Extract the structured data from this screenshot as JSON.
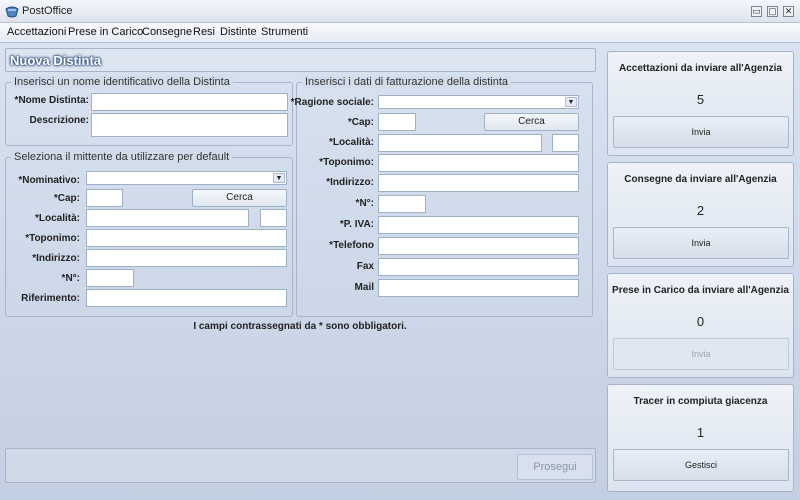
{
  "window": {
    "title": "PostOffice",
    "controls": [
      "▭",
      "▢",
      "✕"
    ]
  },
  "menu": [
    "Accettazioni",
    "Prese in Carico",
    "Consegne",
    "Resi",
    "Distinte",
    "Strumenti"
  ],
  "page_title": "Nuova Distinta",
  "distinta_group": {
    "legend": "Inserisci un nome identificativo della Distinta",
    "name_label": "*Nome Distinta:",
    "name_value": "",
    "desc_label": "Descrizione:",
    "desc_value": ""
  },
  "mittente_group": {
    "legend": "Seleziona il mittente da utilizzare per default",
    "nominativo_label": "*Nominativo:",
    "cap_label": "*Cap:",
    "cerca_label": "Cerca",
    "localita_label": "*Località:",
    "toponimo_label": "*Toponimo:",
    "indirizzo_label": "*Indirizzo:",
    "numero_label": "*N°:",
    "riferimento_label": "Riferimento:"
  },
  "fatturazione_group": {
    "legend": "Inserisci i dati di fatturazione della distinta",
    "ragione_label": "*Ragione sociale:",
    "cap_label": "*Cap:",
    "cerca_label": "Cerca",
    "localita_label": "*Località:",
    "toponimo_label": "*Toponimo:",
    "indirizzo_label": "*Indirizzo:",
    "numero_label": "*N°:",
    "piva_label": "*P. IVA:",
    "telefono_label": "*Telefono",
    "fax_label": "Fax",
    "mail_label": "Mail"
  },
  "required_note": "I campi contrassegnati da * sono obbligatori.",
  "proceed_button": "Prosegui",
  "cards": [
    {
      "title": "Accettazioni da inviare all'Agenzia",
      "count": "5",
      "button": "Invia",
      "enabled": true
    },
    {
      "title": "Consegne da inviare all'Agenzia",
      "count": "2",
      "button": "Invia",
      "enabled": true
    },
    {
      "title": "Prese in Carico da inviare all'Agenzia",
      "count": "0",
      "button": "Invia",
      "enabled": false
    },
    {
      "title": "Tracer in compiuta giacenza",
      "count": "1",
      "button": "Gestisci",
      "enabled": true
    }
  ]
}
